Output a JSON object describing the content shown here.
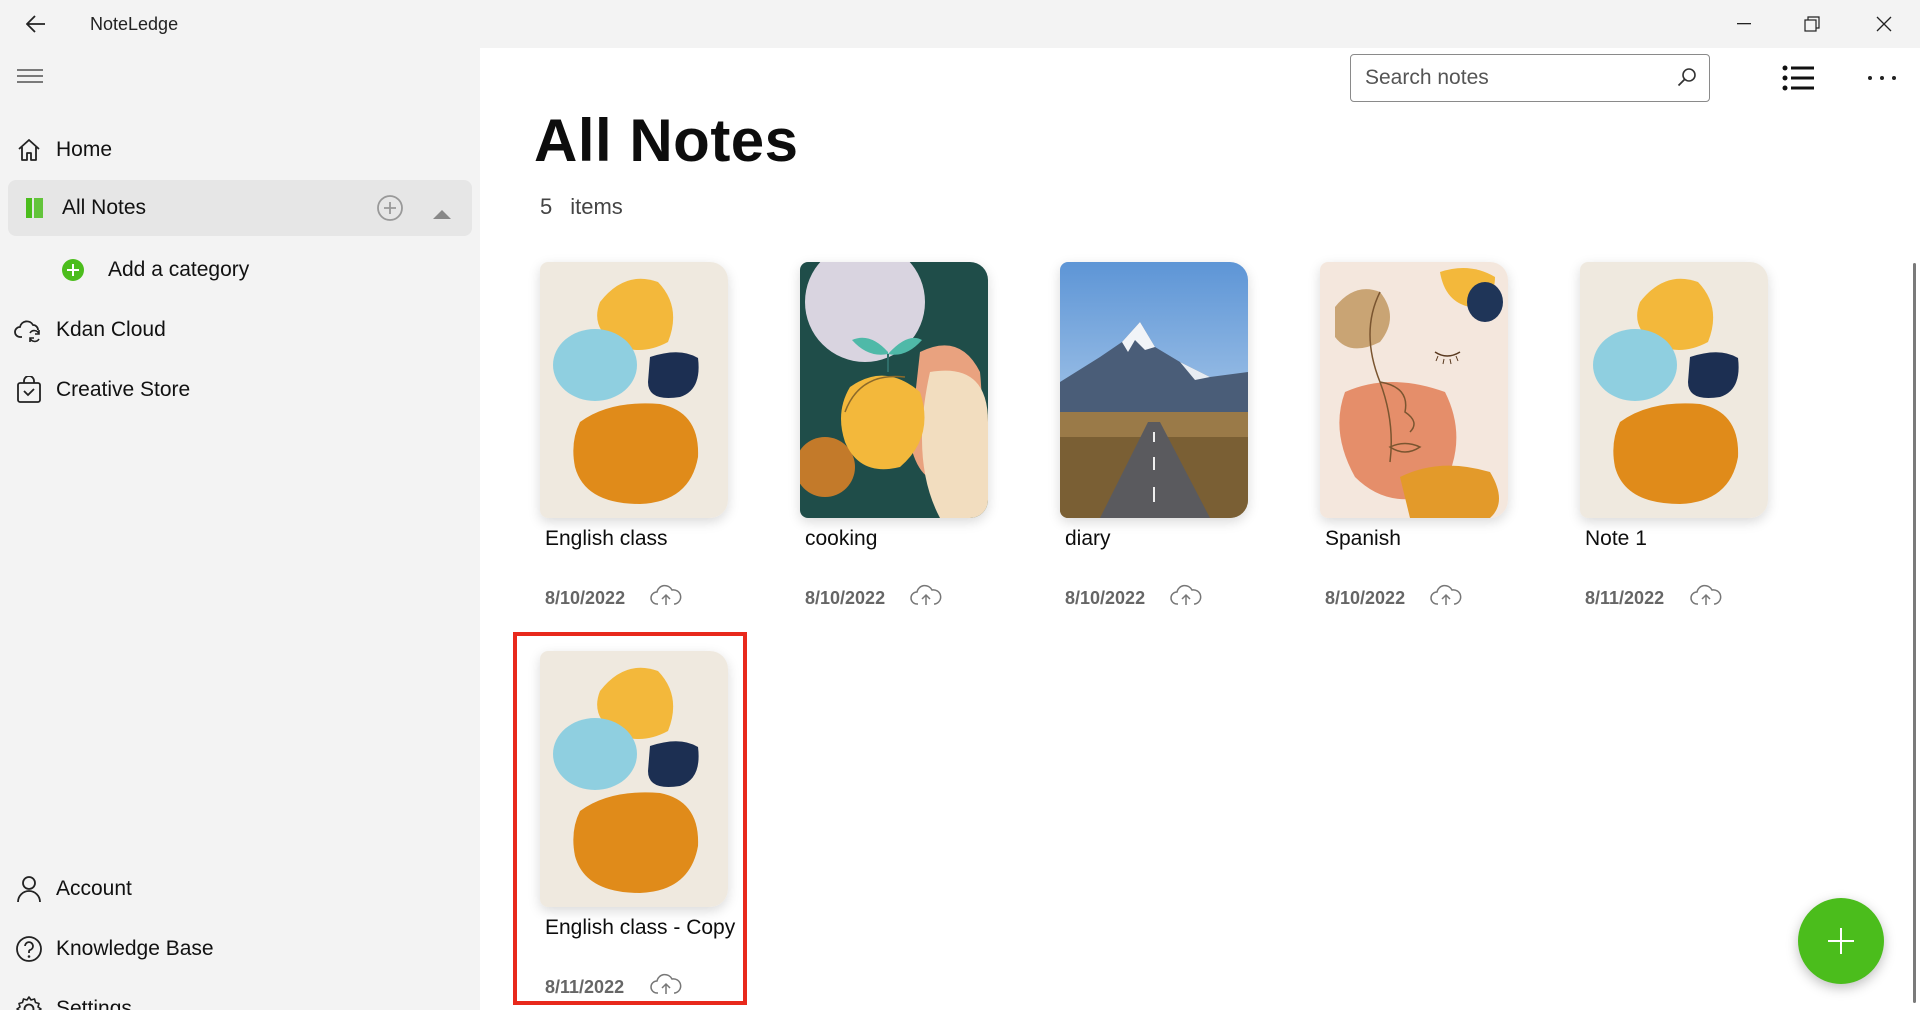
{
  "app": {
    "title": "NoteLedge"
  },
  "sidebar": {
    "items": [
      {
        "label": "Home",
        "icon": "home-icon"
      },
      {
        "label": "All Notes",
        "icon": "notebook-icon"
      },
      {
        "label": "Add a category",
        "icon": "add-circle-icon"
      },
      {
        "label": "Kdan Cloud",
        "icon": "cloud-sync-icon"
      },
      {
        "label": "Creative Store",
        "icon": "shopping-bag-icon"
      }
    ],
    "bottom_items": [
      {
        "label": "Account",
        "icon": "person-icon"
      },
      {
        "label": "Knowledge Base",
        "icon": "help-icon"
      },
      {
        "label": "Settings",
        "icon": "gear-icon"
      }
    ]
  },
  "header": {
    "search_placeholder": "Search notes"
  },
  "main": {
    "title": "All Notes",
    "count": "5",
    "count_label": "items",
    "notes": [
      {
        "name": "English class",
        "date": "8/10/2022",
        "cover": "abstract-shapes"
      },
      {
        "name": "cooking",
        "date": "8/10/2022",
        "cover": "lemon-art"
      },
      {
        "name": "diary",
        "date": "8/10/2022",
        "cover": "mountain-road"
      },
      {
        "name": "Spanish",
        "date": "8/10/2022",
        "cover": "face-line-art"
      },
      {
        "name": "Note 1",
        "date": "8/11/2022",
        "cover": "abstract-shapes"
      },
      {
        "name": "English class - Copy",
        "date": "8/11/2022",
        "cover": "abstract-shapes"
      }
    ]
  },
  "colors": {
    "accent_green": "#4bbd1c",
    "highlight_red": "#e8291c",
    "sidebar_bg": "#f3f3f3"
  }
}
